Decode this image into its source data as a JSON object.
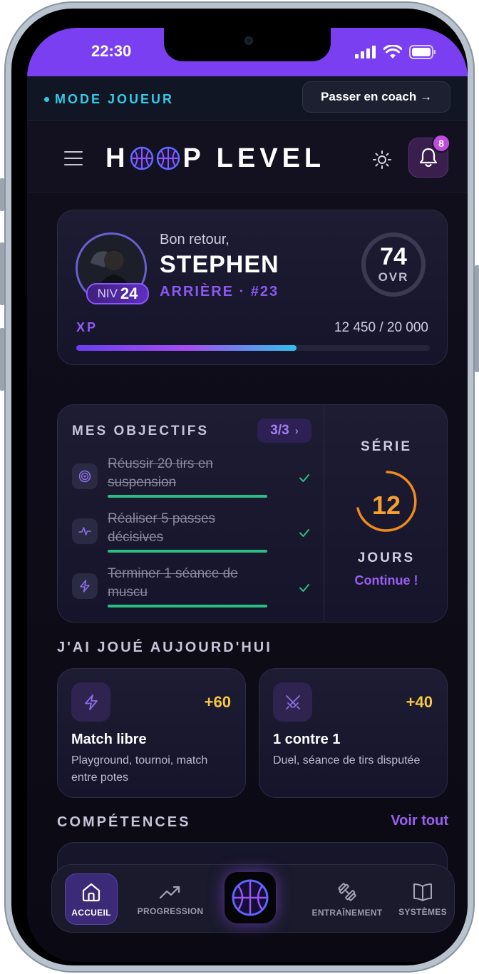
{
  "status_bar": {
    "time": "22:30"
  },
  "mode_bar": {
    "label": "MODE JOUEUR",
    "switch_button": "Passer en coach →"
  },
  "header": {
    "logo_left": "H",
    "logo_right": "P LEVEL",
    "notification_count": "8",
    "icons": [
      "menu-icon",
      "sun-icon",
      "bell-icon"
    ]
  },
  "profile": {
    "greeting": "Bon retour,",
    "name": "STEPHEN",
    "role": "ARRIÈRE · #23",
    "level_prefix": "NIV",
    "level": "24",
    "ovr_value": "74",
    "ovr_label": "OVR",
    "xp_label": "XP",
    "xp_text": "12 450 / 20 000",
    "xp_progress": 0.6225
  },
  "objectives": {
    "title": "MES OBJECTIFS",
    "count": "3/3",
    "items": [
      {
        "text": "Réussir 20 tirs en suspension",
        "icon": "target-icon",
        "done": true
      },
      {
        "text": "Réaliser 5 passes décisives",
        "icon": "pulse-icon",
        "done": true
      },
      {
        "text": "Terminer 1 séance de muscu",
        "icon": "bolt-icon",
        "done": true
      }
    ]
  },
  "streak": {
    "label": "SÉRIE",
    "value": "12",
    "unit": "JOURS",
    "cta": "Continue !"
  },
  "played_today": {
    "title": "J'AI JOUÉ AUJOURD'HUI",
    "cards": [
      {
        "points": "+60",
        "title": "Match libre",
        "desc": "Playground, tournoi, match entre potes",
        "icon": "bolt-icon"
      },
      {
        "points": "+40",
        "title": "1 contre 1",
        "desc": "Duel, séance de tirs disputée",
        "icon": "crossed-swords-icon"
      }
    ]
  },
  "skills": {
    "title": "COMPÉTENCES",
    "see_all": "Voir tout"
  },
  "nav": {
    "items": [
      {
        "label": "ACCUEIL",
        "icon": "home-icon",
        "active": true
      },
      {
        "label": "PROGRESSION",
        "icon": "trend-up-icon"
      },
      {
        "label": "ENTRAÎNEMENT",
        "icon": "dumbbell-icon"
      },
      {
        "label": "SYSTÈMES",
        "icon": "book-icon"
      }
    ],
    "center_icon": "basketball-icon"
  },
  "colors": {
    "accent_purple": "#8b58f0",
    "accent_cyan": "#35c9e9",
    "streak_orange": "#f5a12c",
    "points_yellow": "#f5c842",
    "success_green": "#2dbd82"
  }
}
